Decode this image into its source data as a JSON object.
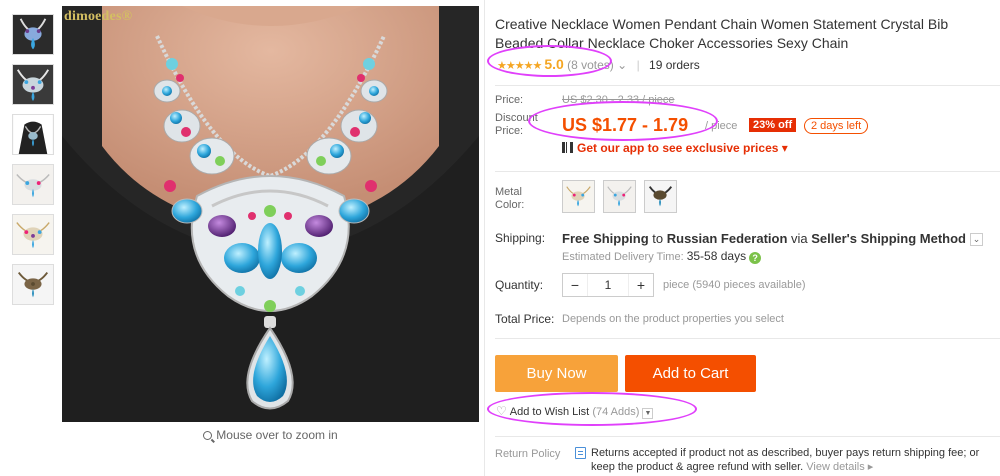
{
  "brand": "dimoedes®",
  "zoom_hint": "Mouse over to zoom in",
  "title": "Creative Necklace Women Pendant Chain Women Statement Crystal Bib Beaded Collar Necklace Choker Accessories Sexy Chain",
  "rating": {
    "stars": "★★★★★",
    "score": "5.0",
    "votes": "(8 votes)",
    "orders": "19 orders"
  },
  "price": {
    "price_label": "Price:",
    "old_price": "US $2.30 - 2.33 / piece",
    "discount_label_1": "Discount",
    "discount_label_2": "Price:",
    "discount_price": "US $1.77 - 1.79",
    "per_piece": "/ piece",
    "off_badge": "23% off",
    "days_left": "2 days left",
    "app_promo": "Get our app to see exclusive prices ▾"
  },
  "color": {
    "label_1": "Metal",
    "label_2": "Color:"
  },
  "shipping": {
    "label": "Shipping:",
    "main_prefix": "Free Shipping",
    "main_mid": " to ",
    "country": "Russian Federation",
    "via": " via ",
    "method": "Seller's Shipping Method",
    "delivery_label": "Estimated Delivery Time: ",
    "delivery_days": "35-58 days",
    "help": "?"
  },
  "quantity": {
    "label": "Quantity:",
    "minus": "−",
    "value": "1",
    "plus": "+",
    "note": "piece (5940 pieces available)"
  },
  "total": {
    "label": "Total Price:",
    "note": "Depends on the product properties you select"
  },
  "buttons": {
    "buy_now": "Buy Now",
    "add_to_cart": "Add to Cart"
  },
  "wishlist": {
    "label": "Add to Wish List",
    "count": "(74 Adds)"
  },
  "returns": {
    "label": "Return Policy",
    "text": "Returns accepted if product not as described, buyer pays return shipping fee; or keep the product & agree refund with seller. ",
    "link": "View details ▸"
  },
  "colors": {
    "price_orange": "#f44f00",
    "buy_now_bg": "#f7a23a",
    "badge_red": "#e62e04",
    "annotation_magenta": "#e040fb"
  }
}
